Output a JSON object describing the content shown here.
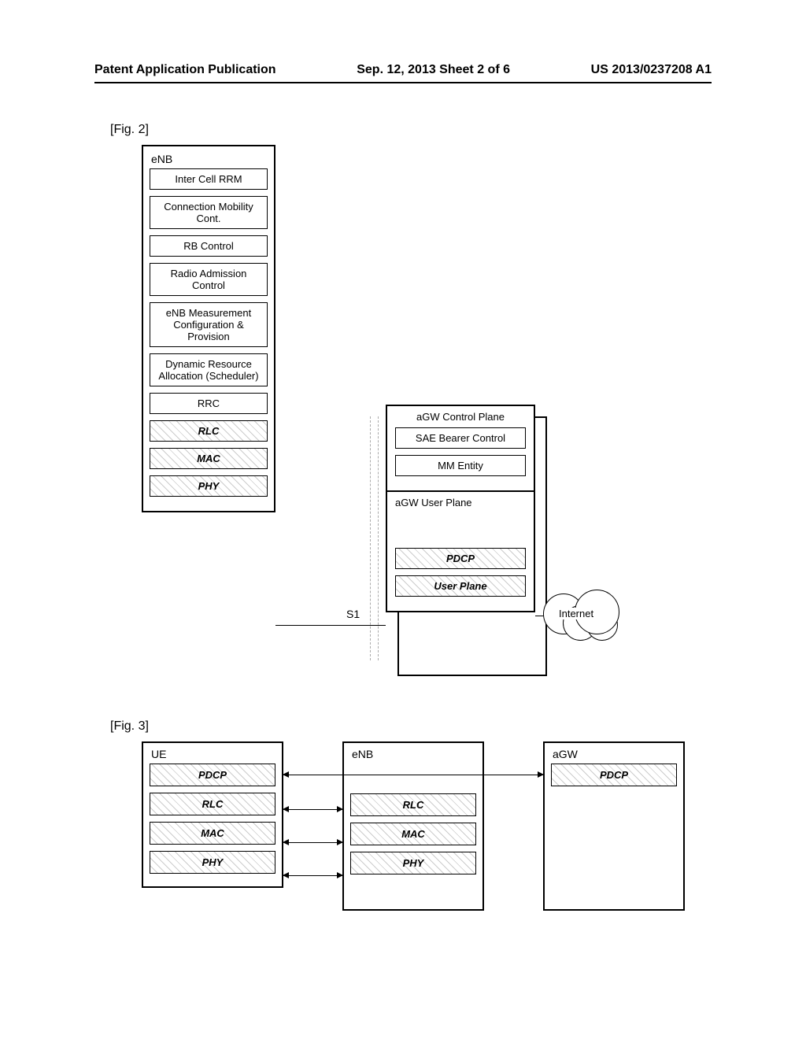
{
  "header": {
    "left": "Patent Application Publication",
    "center": "Sep. 12, 2013  Sheet 2 of 6",
    "right": "US 2013/0237208 A1"
  },
  "fig2": {
    "label": "[Fig. 2]",
    "enb": {
      "title": "eNB",
      "functions": [
        "Inter Cell RRM",
        "Connection Mobility Cont.",
        "RB Control",
        "Radio Admission Control",
        "eNB Measurement Configuration & Provision",
        "Dynamic Resource Allocation (Scheduler)",
        "RRC"
      ],
      "layers": [
        "RLC",
        "MAC",
        "PHY"
      ]
    },
    "agw_cp": {
      "title": "aGW Control Plane",
      "functions": [
        "SAE Bearer Control",
        "MM Entity"
      ]
    },
    "agw_up": {
      "title": "aGW User Plane",
      "layers": [
        "PDCP",
        "User Plane"
      ]
    },
    "interface": "S1",
    "internet": "Internet"
  },
  "fig3": {
    "label": "[Fig. 3]",
    "ue": {
      "title": "UE",
      "layers": [
        "PDCP",
        "RLC",
        "MAC",
        "PHY"
      ]
    },
    "enb": {
      "title": "eNB",
      "layers": [
        "RLC",
        "MAC",
        "PHY"
      ]
    },
    "agw": {
      "title": "aGW",
      "layers": [
        "PDCP"
      ]
    }
  }
}
